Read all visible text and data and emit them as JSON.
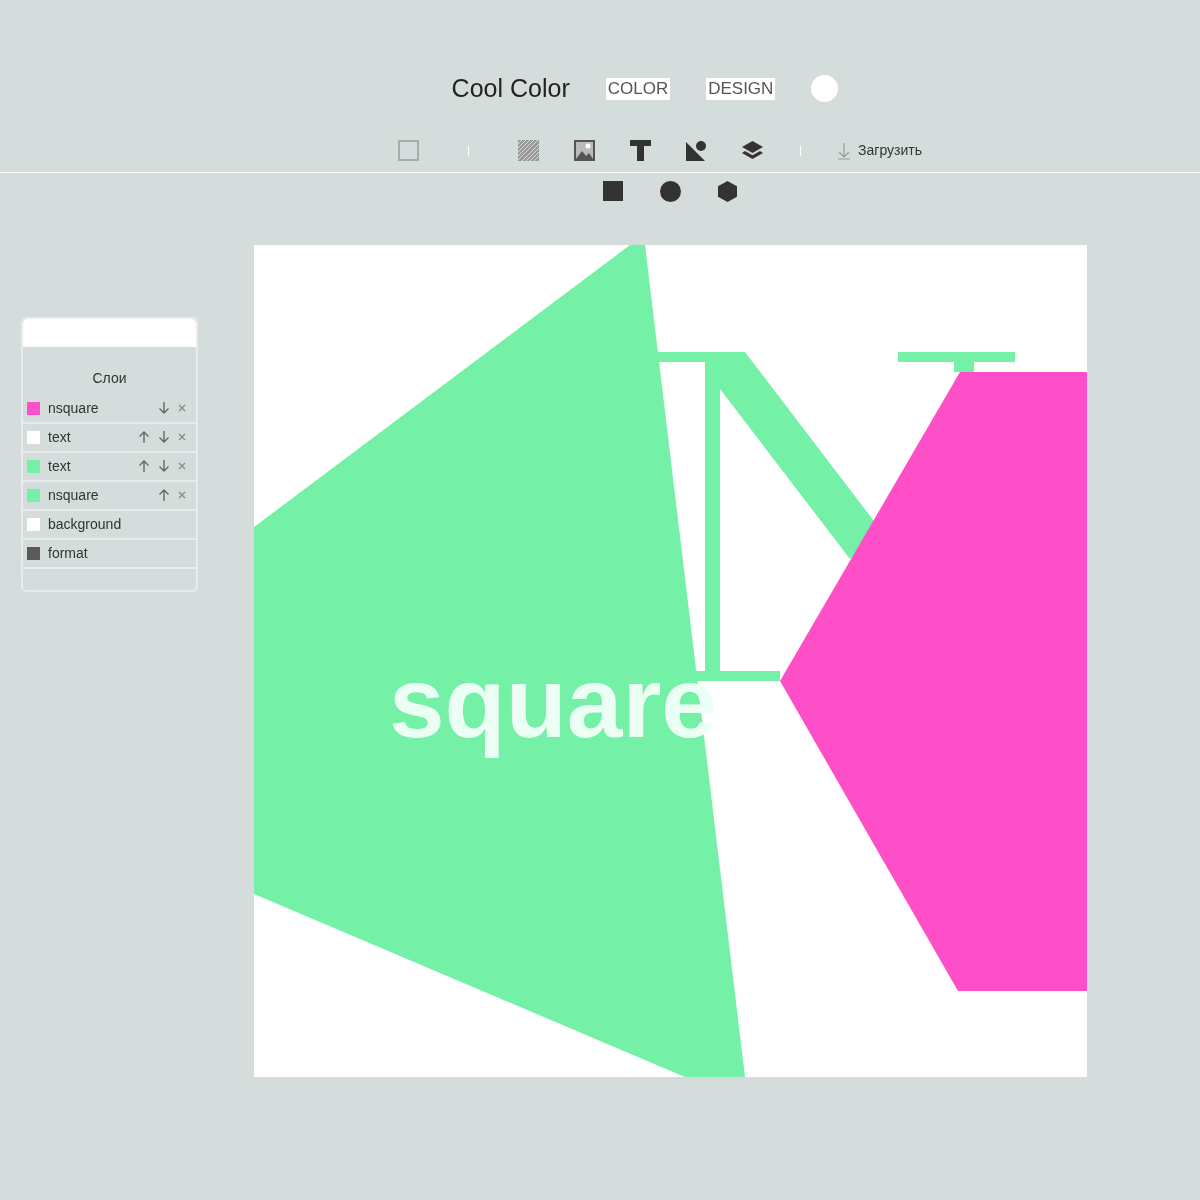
{
  "header": {
    "title": "Cool Color",
    "nav": [
      "COLOR",
      "DESIGN"
    ]
  },
  "toolbar": {
    "download": "Загрузить"
  },
  "layers_panel": {
    "title": "Слои",
    "layers": [
      {
        "name": "nsquare",
        "color": "#ff4fc8",
        "move_up": false,
        "move_down": true,
        "removable": true
      },
      {
        "name": "text",
        "color": "#ffffff",
        "move_up": true,
        "move_down": true,
        "removable": true
      },
      {
        "name": "text",
        "color": "#74f0a7",
        "move_up": true,
        "move_down": true,
        "removable": true
      },
      {
        "name": "nsquare",
        "color": "#74f0a7",
        "move_up": true,
        "move_down": false,
        "removable": true
      },
      {
        "name": "background",
        "color": "#ffffff",
        "move_up": false,
        "move_down": false,
        "removable": false
      },
      {
        "name": "format",
        "color": "#5a5a5a",
        "move_up": false,
        "move_down": false,
        "removable": false
      }
    ]
  },
  "canvas": {
    "texts": [
      "square"
    ]
  }
}
